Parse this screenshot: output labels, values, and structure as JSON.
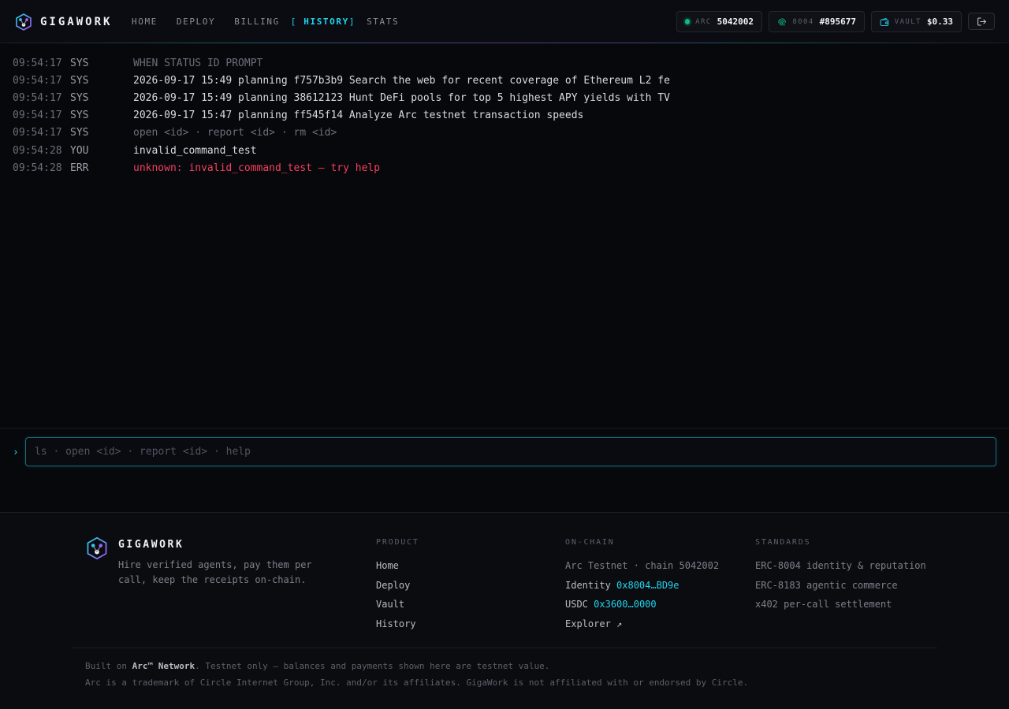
{
  "brand": {
    "name": "GIGAWORK"
  },
  "nav": {
    "items": [
      {
        "label": "HOME"
      },
      {
        "label": "DEPLOY"
      },
      {
        "label": "BILLING"
      },
      {
        "label": "HISTORY",
        "active": true
      },
      {
        "label": "STATS"
      }
    ],
    "bracket_open": "[",
    "bracket_close": "]"
  },
  "status": {
    "arc": {
      "label": "ARC",
      "value": "5042002"
    },
    "identity": {
      "label": "8004",
      "value": "#895677"
    },
    "vault": {
      "label": "VAULT",
      "value": "$0.33"
    }
  },
  "log": [
    {
      "time": "09:54:17",
      "source": "SYS",
      "message": "WHEN STATUS ID PROMPT",
      "style": "dim"
    },
    {
      "time": "09:54:17",
      "source": "SYS",
      "message": "2026-09-17 15:49 planning f757b3b9 Search the web for recent coverage of Ethereum L2 fe",
      "style": "normal"
    },
    {
      "time": "09:54:17",
      "source": "SYS",
      "message": "2026-09-17 15:49 planning 38612123 Hunt DeFi pools for top 5 highest APY yields with TV",
      "style": "normal"
    },
    {
      "time": "09:54:17",
      "source": "SYS",
      "message": "2026-09-17 15:47 planning ff545f14 Analyze Arc testnet transaction speeds",
      "style": "normal"
    },
    {
      "time": "09:54:17",
      "source": "SYS",
      "message": "open <id> · report <id> · rm <id>",
      "style": "dim"
    },
    {
      "time": "09:54:28",
      "source": "YOU",
      "message": "invalid_command_test",
      "style": "normal"
    },
    {
      "time": "09:54:28",
      "source": "ERR",
      "message": "unknown: invalid_command_test — try help",
      "style": "err"
    }
  ],
  "prompt": {
    "caret": "›",
    "placeholder": "ls · open <id> · report <id> · help",
    "value": ""
  },
  "footer": {
    "brand": "GIGAWORK",
    "tagline": "Hire verified agents, pay them per call, keep the receipts on-chain.",
    "product": {
      "heading": "PRODUCT",
      "links": [
        "Home",
        "Deploy",
        "Vault",
        "History"
      ]
    },
    "onchain": {
      "heading": "ON-CHAIN",
      "network": "Arc Testnet · chain 5042002",
      "identity_label": "Identity",
      "identity_value": "0x8004…BD9e",
      "usdc_label": "USDC",
      "usdc_value": "0x3600…0000",
      "explorer": "Explorer ↗"
    },
    "standards": {
      "heading": "STANDARDS",
      "items": [
        "ERC-8004 identity & reputation",
        "ERC-8183 agentic commerce",
        "x402 per-call settlement"
      ]
    },
    "note1_prefix": "Built on ",
    "note1_bold": "Arc™ Network",
    "note1_suffix": ". Testnet only — balances and payments shown here are testnet value.",
    "note2": "Arc is a trademark of Circle Internet Group, Inc. and/or its affiliates. GigaWork is not affiliated with or endorsed by Circle."
  }
}
